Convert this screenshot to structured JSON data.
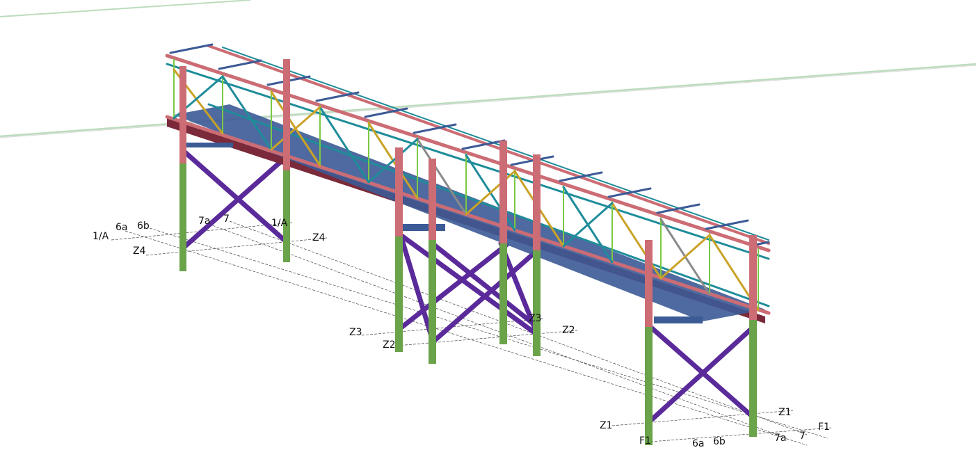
{
  "colors": {
    "background": "#ffffff",
    "horizon": "#9ccf9c",
    "column": "#cc6c74",
    "column_base": "#6aa34a",
    "bracing": "#5a2a9a",
    "deck": "#3c5a96",
    "truss_teal": "#1e8c9a",
    "truss_yellow": "#c9a227",
    "truss_green": "#7ac943",
    "truss_grey": "#8a8a8a",
    "gridline": "#333333"
  },
  "grid_labels": {
    "left_group": {
      "label_1a_left": "1/A",
      "label_6a": "6a",
      "label_6b": "6b",
      "label_7a": "7a",
      "label_7": "7",
      "label_1a_right": "1/A",
      "label_z4_right": "Z4",
      "label_z4_left": "Z4"
    },
    "middle_group": {
      "label_z3_left": "Z3",
      "label_z3_right": "Z3",
      "label_z2_right": "Z2",
      "label_z2_left": "Z2"
    },
    "right_group": {
      "label_z1_right": "Z1",
      "label_f1_right": "F1",
      "label_7a": "7a",
      "label_7": "7",
      "label_z1_left": "Z1",
      "label_f1_left": "F1",
      "label_6a": "6a",
      "label_6b": "6b"
    }
  }
}
